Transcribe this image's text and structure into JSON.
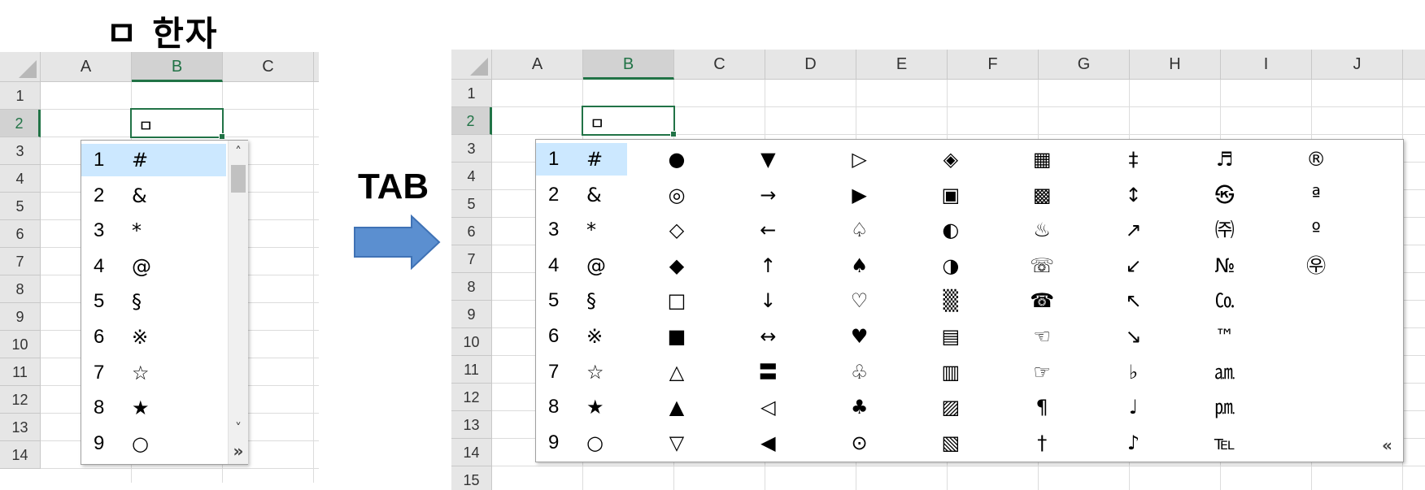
{
  "title": "ㅁ 한자",
  "tab_label": "TAB",
  "active_cell_value": "ㅁ",
  "left_sheet": {
    "columns": [
      "A",
      "B",
      "C"
    ],
    "rows": [
      "1",
      "2",
      "3",
      "4",
      "5",
      "6",
      "7",
      "8",
      "9",
      "10",
      "11",
      "12",
      "13",
      "14"
    ]
  },
  "right_sheet": {
    "columns": [
      "A",
      "B",
      "C",
      "D",
      "E",
      "F",
      "G",
      "H",
      "I",
      "J"
    ],
    "rows": [
      "1",
      "2",
      "3",
      "4",
      "5",
      "6",
      "7",
      "8",
      "9",
      "10",
      "11",
      "12",
      "13",
      "14",
      "15"
    ]
  },
  "candidate_list": {
    "numbers": [
      "1",
      "2",
      "3",
      "4",
      "5",
      "6",
      "7",
      "8",
      "9"
    ],
    "symbols": [
      "#",
      "&",
      "*",
      "@",
      "§",
      "※",
      "☆",
      "★",
      "○"
    ],
    "scroll_up": "˄",
    "scroll_down": "˅",
    "expand_icon": "»"
  },
  "candidate_grid": {
    "columns": [
      [
        "●",
        "◎",
        "◇",
        "◆",
        "□",
        "■",
        "△",
        "▲",
        "▽"
      ],
      [
        "▼",
        "→",
        "←",
        "↑",
        "↓",
        "↔",
        "〓",
        "◁",
        "◀"
      ],
      [
        "▷",
        "▶",
        "♤",
        "♠",
        "♡",
        "♥",
        "♧",
        "♣",
        "⊙"
      ],
      [
        "◈",
        "▣",
        "◐",
        "◑",
        "▒",
        "▤",
        "▥",
        "▨",
        "▧"
      ],
      [
        "▦",
        "▩",
        "♨",
        "☏",
        "☎",
        "☜",
        "☞",
        "¶",
        "†"
      ],
      [
        "‡",
        "↕",
        "↗",
        "↙",
        "↖",
        "↘",
        "♭",
        "♩",
        "♪"
      ],
      [
        "♬",
        "㉿",
        "㈜",
        "№",
        "㏇",
        "™",
        "㏂",
        "㏘",
        "℡"
      ],
      [
        "®",
        "ª",
        "º",
        "㉾",
        "",
        "",
        "",
        "",
        ""
      ]
    ],
    "collapse_icon": "«"
  },
  "colors": {
    "accent_green": "#217346",
    "highlight": "#cce8ff",
    "arrow_fill": "#5b8fd0"
  }
}
